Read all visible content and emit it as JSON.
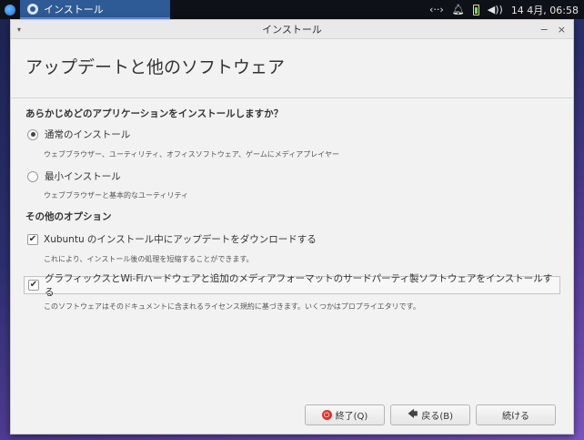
{
  "panel": {
    "task_label": "インストール",
    "clock": "14 4月, 06:58",
    "icons": [
      "network-icon",
      "bell-icon",
      "battery-icon",
      "volume-icon"
    ]
  },
  "window": {
    "title": "インストール",
    "minimize": "−",
    "close": "×",
    "menu": "▾"
  },
  "page": {
    "title": "アップデートと他のソフトウェア",
    "question": "あらかじめどのアプリケーションをインストールしますか？",
    "normal_install": {
      "label": "通常のインストール",
      "desc": "ウェブブラウザー、ユーティリティ、オフィスソフトウェア、ゲームにメディアプレイヤー",
      "selected": true
    },
    "minimal_install": {
      "label": "最小インストール",
      "desc": "ウェブブラウザーと基本的なユーティリティ",
      "selected": false
    },
    "other_options": "その他のオプション",
    "download_updates": {
      "label": "Xubuntu のインストール中にアップデートをダウンロードする",
      "desc": "これにより、インストール後の処理を短縮することができます。",
      "checked": true
    },
    "third_party": {
      "label": "グラフィックスとWi-Fiハードウェアと追加のメディアフォーマットのサードパーティ製ソフトウェアをインストールする",
      "desc": "このソフトウェアはそのドキュメントに含まれるライセンス規約に基づきます。いくつかはプロプライエタリです。",
      "checked": true
    }
  },
  "buttons": {
    "quit": "終了(Q)",
    "back": "戻る(B)",
    "continue": "続ける"
  }
}
